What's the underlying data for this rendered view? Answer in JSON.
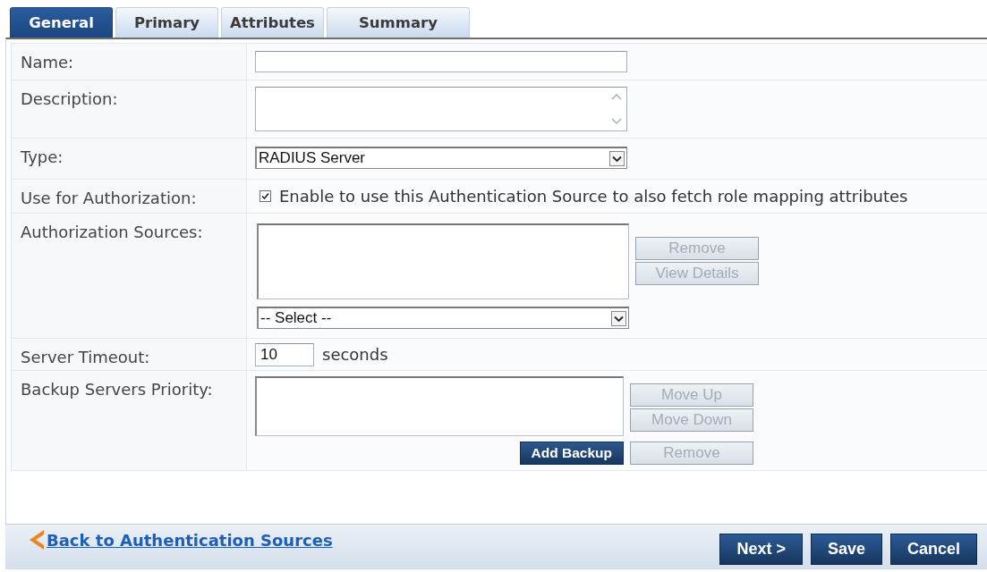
{
  "tabs": [
    {
      "label": "General",
      "selected": true
    },
    {
      "label": "Primary",
      "selected": false
    },
    {
      "label": "Attributes",
      "selected": false
    },
    {
      "label": "Summary",
      "selected": false
    }
  ],
  "form": {
    "rows": [
      {
        "kind": "text",
        "label": "Name:"
      },
      {
        "kind": "textarea",
        "label": "Description:"
      },
      {
        "kind": "select",
        "label": "Type:",
        "value": "RADIUS Server"
      },
      {
        "kind": "checkbox",
        "label": "Use for Authorization:",
        "checked": true,
        "text": "Enable to use this Authentication Source to also fetch role mapping attributes"
      },
      {
        "kind": "list",
        "label": "Authorization Sources:",
        "select": "-- Select --",
        "buttons": [
          {
            "label": "Remove",
            "disabled": true
          },
          {
            "label": "View Details",
            "disabled": true
          }
        ]
      },
      {
        "kind": "number",
        "label": "Server Timeout:",
        "value": "10",
        "unit": "seconds"
      },
      {
        "kind": "list",
        "label": "Backup Servers Priority:",
        "buttons": [
          {
            "label": "Move Up",
            "disabled": true
          },
          {
            "label": "Move Down",
            "disabled": true
          }
        ],
        "actions": [
          {
            "label": "Add Backup",
            "disabled": false
          },
          {
            "label": "Remove",
            "disabled": true
          }
        ]
      }
    ]
  },
  "footer": {
    "back_link": "Back to Authentication Sources",
    "buttons": [
      "Next >",
      "Save",
      "Cancel"
    ]
  }
}
